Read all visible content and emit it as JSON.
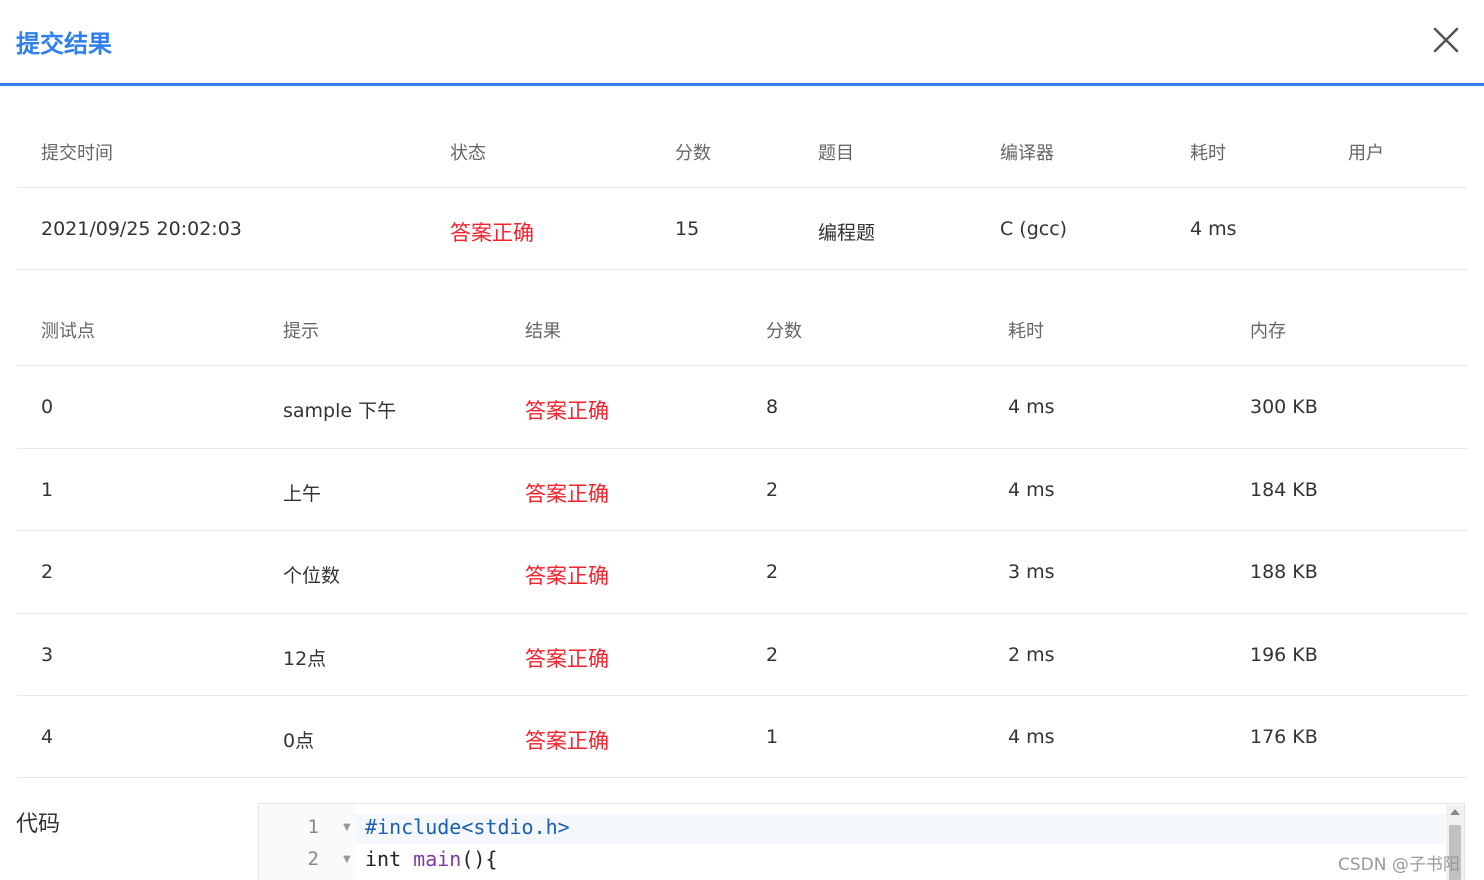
{
  "dialog": {
    "title": "提交结果"
  },
  "summary": {
    "headers": [
      "提交时间",
      "状态",
      "分数",
      "题目",
      "编译器",
      "耗时",
      "用户"
    ],
    "row": [
      "2021/09/25 20:02:03",
      "答案正确",
      "15",
      "编程题",
      "C (gcc)",
      "4 ms",
      ""
    ]
  },
  "tests": {
    "headers": [
      "测试点",
      "提示",
      "结果",
      "分数",
      "耗时",
      "内存"
    ],
    "rows": [
      [
        "0",
        "sample 下午",
        "答案正确",
        "8",
        "4 ms",
        "300 KB"
      ],
      [
        "1",
        "上午",
        "答案正确",
        "2",
        "4 ms",
        "184 KB"
      ],
      [
        "2",
        "个位数",
        "答案正确",
        "2",
        "3 ms",
        "188 KB"
      ],
      [
        "3",
        "12点",
        "答案正确",
        "2",
        "2 ms",
        "196 KB"
      ],
      [
        "4",
        "0点",
        "答案正确",
        "1",
        "4 ms",
        "176 KB"
      ]
    ]
  },
  "code": {
    "label": "代码",
    "lines": [
      {
        "num": "1",
        "pre": "#include<stdio.h>",
        "type": "",
        "fn": "",
        "rest": ""
      },
      {
        "num": "2",
        "pre": "",
        "type": "int",
        "fn": "main",
        "rest": "(){"
      }
    ]
  },
  "watermark": "CSDN @子书阳",
  "colors": {
    "accent": "#2f80ed",
    "status_ok": "#f5222d"
  }
}
